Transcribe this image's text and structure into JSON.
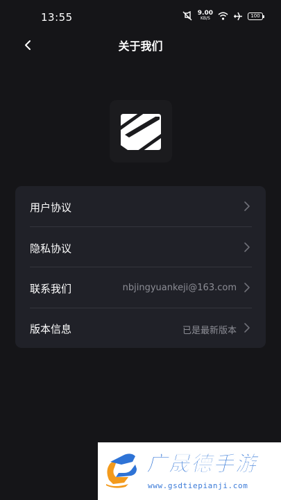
{
  "status_bar": {
    "time": "13:55",
    "net_speed_value": "9.00",
    "net_speed_unit": "KB/S",
    "battery": "100",
    "icons": [
      "mute-icon",
      "wifi-icon",
      "airplane-icon",
      "battery-icon"
    ]
  },
  "header": {
    "title": "关于我们",
    "back_icon": "chevron-left-icon"
  },
  "app_logo": {
    "icon": "app-logo-icon"
  },
  "menu": {
    "items": [
      {
        "label": "用户协议",
        "value": ""
      },
      {
        "label": "隐私协议",
        "value": ""
      },
      {
        "label": "联系我们",
        "value": "nbjingyuankeji@163.com"
      },
      {
        "label": "版本信息",
        "value": "已是最新版本"
      }
    ]
  },
  "watermark": {
    "title": "广晟德手游",
    "url": "www.gsdtiepianji.com",
    "colors": {
      "orange": "#f39a1c",
      "blue": "#2e73d6"
    }
  },
  "colors": {
    "background": "#151518",
    "card": "#202128",
    "secondary_text": "#8c8d95"
  }
}
